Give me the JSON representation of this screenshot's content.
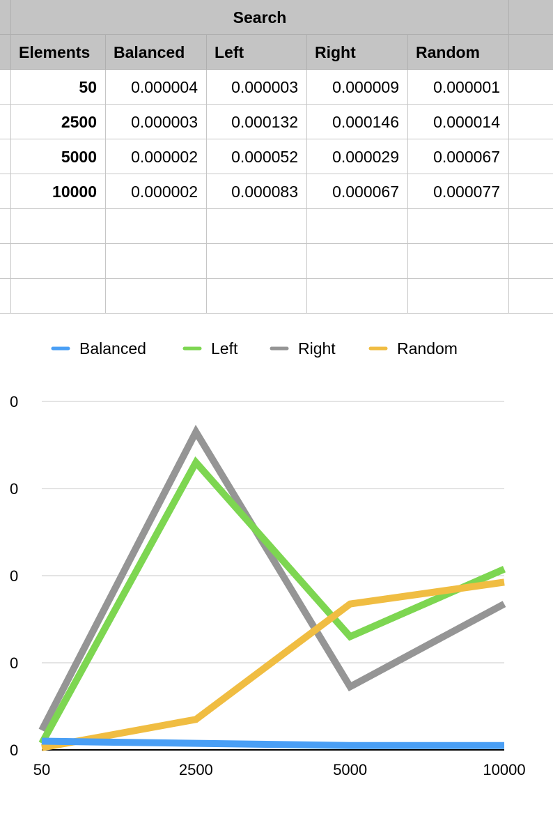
{
  "table": {
    "title": "Search",
    "headers": [
      "Elements",
      "Balanced",
      "Left",
      "Right",
      "Random"
    ],
    "rows": [
      [
        "50",
        "0.000004",
        "0.000003",
        "0.000009",
        "0.000001"
      ],
      [
        "2500",
        "0.000003",
        "0.000132",
        "0.000146",
        "0.000014"
      ],
      [
        "5000",
        "0.000002",
        "0.000052",
        "0.000029",
        "0.000067"
      ],
      [
        "10000",
        "0.000002",
        "0.000083",
        "0.000067",
        "0.000077"
      ]
    ]
  },
  "colors": {
    "balanced": "#4a9ff5",
    "left": "#7dd651",
    "right": "#959595",
    "random": "#f0bd42",
    "header_bg": "#c4c4c4",
    "grid": "#c6c6c6"
  },
  "chart_data": {
    "type": "line",
    "categories": [
      "50",
      "2500",
      "5000",
      "10000"
    ],
    "series": [
      {
        "name": "Balanced",
        "values": [
          4e-06,
          3e-06,
          2e-06,
          2e-06
        ]
      },
      {
        "name": "Left",
        "values": [
          3e-06,
          0.000132,
          5.2e-05,
          8.3e-05
        ]
      },
      {
        "name": "Right",
        "values": [
          9e-06,
          0.000146,
          2.9e-05,
          6.7e-05
        ]
      },
      {
        "name": "Random",
        "values": [
          1e-06,
          1.4e-05,
          6.7e-05,
          7.7e-05
        ]
      }
    ],
    "yticks": [
      "0",
      "0",
      "0",
      "0",
      "0"
    ],
    "ylim": [
      0,
      0.00016
    ],
    "legend_position": "top",
    "grid": true
  }
}
